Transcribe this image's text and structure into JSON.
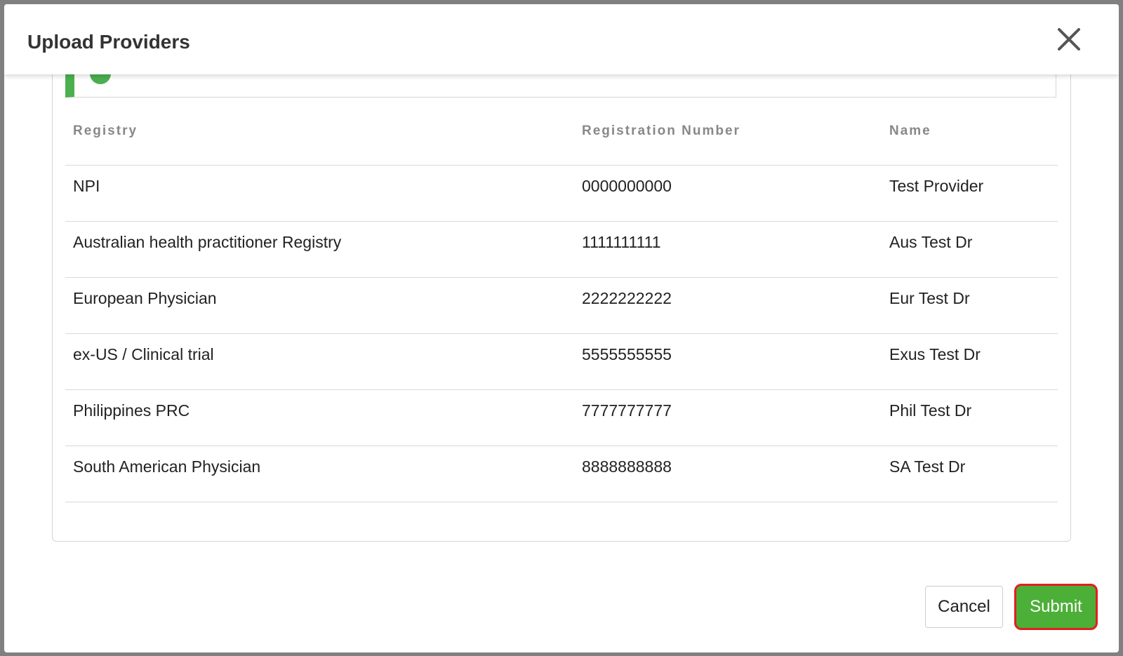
{
  "dialog": {
    "title": "Upload Providers",
    "close_icon": "close-icon"
  },
  "banner": {
    "status_icon": "success-check-icon",
    "accent_color": "#4caf50"
  },
  "table": {
    "headers": [
      "Registry",
      "Registration Number",
      "Name"
    ],
    "rows": [
      [
        "NPI",
        "0000000000",
        "Test Provider"
      ],
      [
        "Australian health practitioner Registry",
        "1111111111",
        "Aus Test Dr"
      ],
      [
        "European Physician",
        "2222222222",
        "Eur Test Dr"
      ],
      [
        "ex-US / Clinical trial",
        "5555555555",
        "Exus Test Dr"
      ],
      [
        "Philippines PRC",
        "7777777777",
        "Phil Test Dr"
      ],
      [
        "South American Physician",
        "8888888888",
        "SA Test Dr"
      ]
    ]
  },
  "footer": {
    "cancel_label": "Cancel",
    "submit_label": "Submit",
    "submit_color": "#4caf38",
    "submit_highlight_color": "#e02020"
  }
}
